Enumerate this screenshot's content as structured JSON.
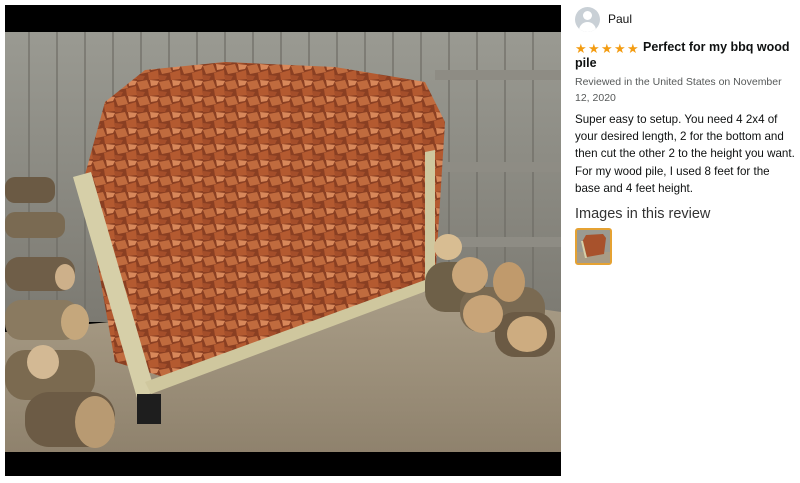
{
  "reviewer": {
    "name": "Paul",
    "avatar_icon": "default-user-icon"
  },
  "review": {
    "rating": 5,
    "rating_max": 5,
    "star_color": "#f39c12",
    "title": "Perfect for my bbq wood pile",
    "meta": "Reviewed in the United States on November 12, 2020",
    "body": "Super easy to setup. You need 4 2x4 of your desired length, 2 for the bottom and then cut the other 2 to the height you want. For my wood pile, I used 8 feet for the base and 4 feet height."
  },
  "images_section": {
    "heading": "Images in this review",
    "thumbnail_accent": "#e5a233"
  }
}
